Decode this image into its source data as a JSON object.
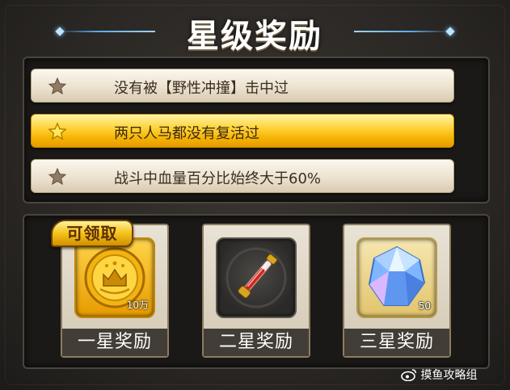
{
  "title": "星级奖励",
  "conditions": [
    {
      "text": "没有被【野性冲撞】击中过",
      "achieved": false
    },
    {
      "text": "两只人马都没有复活过",
      "achieved": true
    },
    {
      "text": "战斗中血量百分比始终大于60%",
      "achieved": false
    }
  ],
  "rewards": [
    {
      "label": "一星奖励",
      "item": "gold-coin-icon",
      "quantity": "10万"
    },
    {
      "label": "二星奖励",
      "item": "red-potion-vial-icon",
      "quantity": ""
    },
    {
      "label": "三星奖励",
      "item": "blue-gem-icon",
      "quantity": "50"
    }
  ],
  "claim_badge": "可领取",
  "watermark": "摸鱼攻略组",
  "colors": {
    "accent_gold": "#f4b100",
    "title_line_blue": "#5aa8e6",
    "panel_dark": "#1a1917"
  }
}
